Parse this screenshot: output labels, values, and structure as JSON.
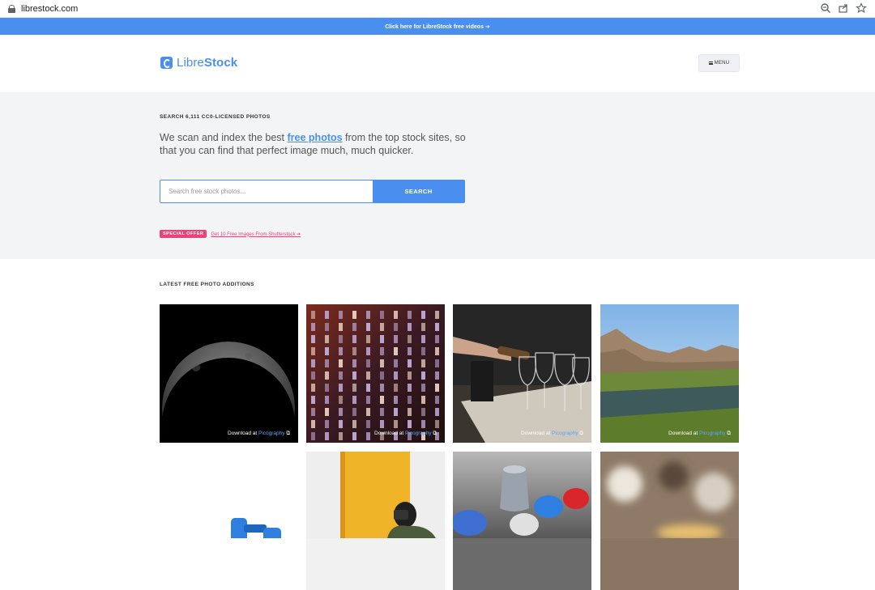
{
  "browser": {
    "url": "librestock.com"
  },
  "promo_bar": {
    "text": "Click here for LibreStock free videos ➔"
  },
  "header": {
    "logo_light": "Libre",
    "logo_bold": "Stock",
    "menu_label": "MENU"
  },
  "hero": {
    "kicker": "SEARCH 6,111 CC0-LICENSED PHOTOS",
    "text_before": "We scan and index the best ",
    "text_link": "free photos",
    "text_after": " from the top stock sites, so that you can find that perfect image much, much quicker.",
    "search_placeholder": "Search free stock photos...",
    "search_button": "SEARCH",
    "offer_badge": "SPECIAL OFFER",
    "offer_link": "Get 10 Free Images From Shutterstock ➔"
  },
  "gallery": {
    "title": "LATEST FREE PHOTO ADDITIONS",
    "credit_prefix": "Download at ",
    "tiles": [
      {
        "subject": "moon",
        "source": "Picography"
      },
      {
        "subject": "illuminated building grid",
        "source": "Picography"
      },
      {
        "subject": "pouring wine into glasses",
        "source": "Picography"
      },
      {
        "subject": "river canyon landscape",
        "source": "Picography"
      },
      {
        "subject": "blue dumbbells",
        "source": ""
      },
      {
        "subject": "photographer against yellow door",
        "source": ""
      },
      {
        "subject": "thimble and thread spools",
        "source": ""
      },
      {
        "subject": "blurred food scene",
        "source": ""
      }
    ]
  },
  "colors": {
    "accent": "#4a8ff0",
    "offer": "#e9437a",
    "hero_bg": "#f3f4f6"
  }
}
